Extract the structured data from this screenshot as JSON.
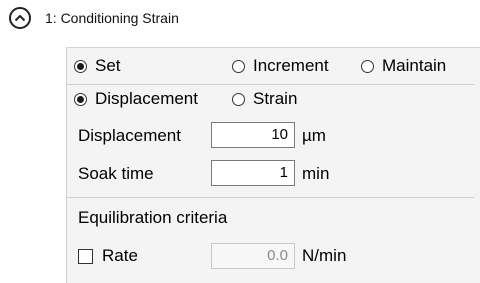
{
  "header": {
    "collapse_icon": "chevron-up-circle-icon",
    "title": "1: Conditioning Strain"
  },
  "mode": {
    "options": [
      {
        "label": "Set",
        "checked": true
      },
      {
        "label": "Increment",
        "checked": false
      },
      {
        "label": "Maintain",
        "checked": false
      }
    ]
  },
  "control_type": {
    "options": [
      {
        "label": "Displacement",
        "checked": true
      },
      {
        "label": "Strain",
        "checked": false
      }
    ]
  },
  "displacement": {
    "label": "Displacement",
    "value": "10",
    "unit": "µm"
  },
  "soak_time": {
    "label": "Soak time",
    "value": "1",
    "unit": "min"
  },
  "equilibration": {
    "label": "Equilibration criteria",
    "rate_label": "Rate",
    "rate_checked": false,
    "rate_value": "0.0",
    "rate_unit": "N/min"
  }
}
